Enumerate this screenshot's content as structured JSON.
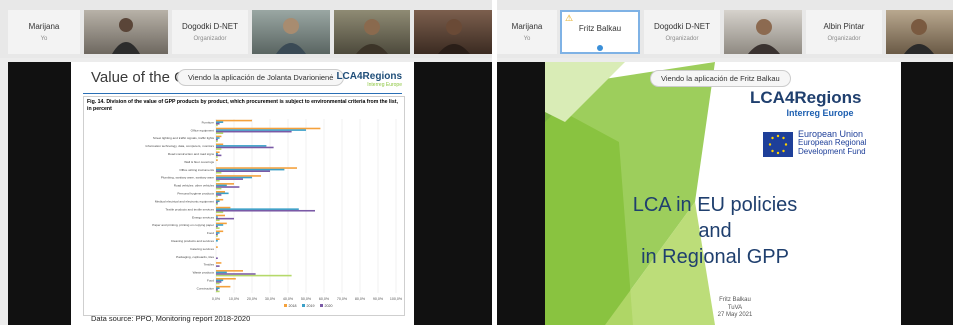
{
  "left_window": {
    "participants": [
      {
        "name": "Marijana",
        "role": "Yo"
      },
      {
        "name": "Dogodki D-NET",
        "role": "Organizador"
      }
    ],
    "share_banner": "Viendo la aplicación de Jolanta Dvarionienė",
    "slide": {
      "title": "Value of the GPP products",
      "logo": "LCA4Regions",
      "logo_sub": "Interreg Europe",
      "figure_caption": "Fig. 14. Division of the value of GPP products by product, which procurement is subject to environmental criteria from the list, in percent",
      "footer": "Data source: PPO, Monitoring report 2018-2020"
    }
  },
  "right_window": {
    "participants": [
      {
        "name": "Marijana",
        "role": "Yo"
      },
      {
        "name": "Fritz Balkau",
        "role": ""
      },
      {
        "name": "Dogodki D-NET",
        "role": "Organizador"
      },
      {
        "name": "Albin Pintar",
        "role": "Organizador"
      }
    ],
    "share_banner": "Viendo la aplicación de Fritz Balkau",
    "slide": {
      "logo": "LCA4Regions",
      "logo_sub": "Interreg Europe",
      "eu_line1": "European Union",
      "eu_line2": "European Regional",
      "eu_line3": "Development Fund",
      "title_line1": "LCA in EU policies",
      "title_line2": "and",
      "title_line3": "in Regional GPP",
      "author": "Fritz Balkau",
      "org": "TuVA",
      "date": "27 May 2021"
    }
  },
  "colors": {
    "orange": "#f4a13c",
    "purple": "#7a5aa6",
    "teal": "#3aa0c8",
    "green": "#8cc63f",
    "lightgreen": "#b5d96a"
  },
  "chart_data": {
    "type": "bar",
    "orientation": "horizontal",
    "title": "",
    "xlabel": "",
    "ylabel": "",
    "categories": [
      "Furniture",
      "Office equipment",
      "Street lighting and traffic signals, traffic lights",
      "Information technology, data, computers, monitors",
      "Road construction and road signs",
      "Wall & floor coverings",
      "Office writing instruments",
      "Plumbing, sanitary ware, sanitary ware",
      "Road vehicles: other vehicles",
      "Personal hygiene products",
      "Medical electrical and electronic equipment",
      "Textile products and textile services",
      "Energy services",
      "Paper and printing, printing on copying paper",
      "Food",
      "Cleaning products and services",
      "Catering services",
      "Packaging, cupboards, tiles",
      "Textiles",
      "Waste products",
      "Food",
      "Construction"
    ],
    "series": [
      {
        "values": [
          20,
          58,
          3,
          4,
          2,
          1,
          45,
          25,
          10,
          5,
          4,
          8,
          5,
          6,
          4,
          2,
          1,
          0,
          3,
          15,
          11,
          8
        ]
      },
      {
        "values": [
          4,
          50,
          2,
          28,
          1,
          0,
          38,
          20,
          6,
          7,
          2,
          46,
          1,
          4,
          2,
          1,
          0,
          0,
          0,
          6,
          4,
          2
        ]
      },
      {
        "values": [
          2,
          42,
          1,
          32,
          3,
          0,
          30,
          15,
          13,
          3,
          1,
          55,
          10,
          1,
          1,
          0,
          0,
          1,
          2,
          22,
          3,
          1
        ]
      },
      {
        "values": [
          1,
          4,
          1,
          3,
          1,
          0,
          3,
          2,
          3,
          1,
          1,
          4,
          2,
          2,
          1,
          0,
          0,
          0,
          0,
          42,
          2,
          2
        ]
      }
    ],
    "x": [
      0,
      10,
      20,
      30,
      40,
      50,
      60,
      70,
      80,
      90,
      100
    ],
    "xtick_labels": [
      "0,0%",
      "10,0%",
      "20,0%",
      "30,0%",
      "40,0%",
      "50,0%",
      "60,0%",
      "70,0%",
      "80,0%",
      "90,0%",
      "100,0%"
    ],
    "legend": [
      "2018",
      "2019",
      "2020"
    ],
    "xlim": [
      0,
      100
    ],
    "grid": true
  }
}
